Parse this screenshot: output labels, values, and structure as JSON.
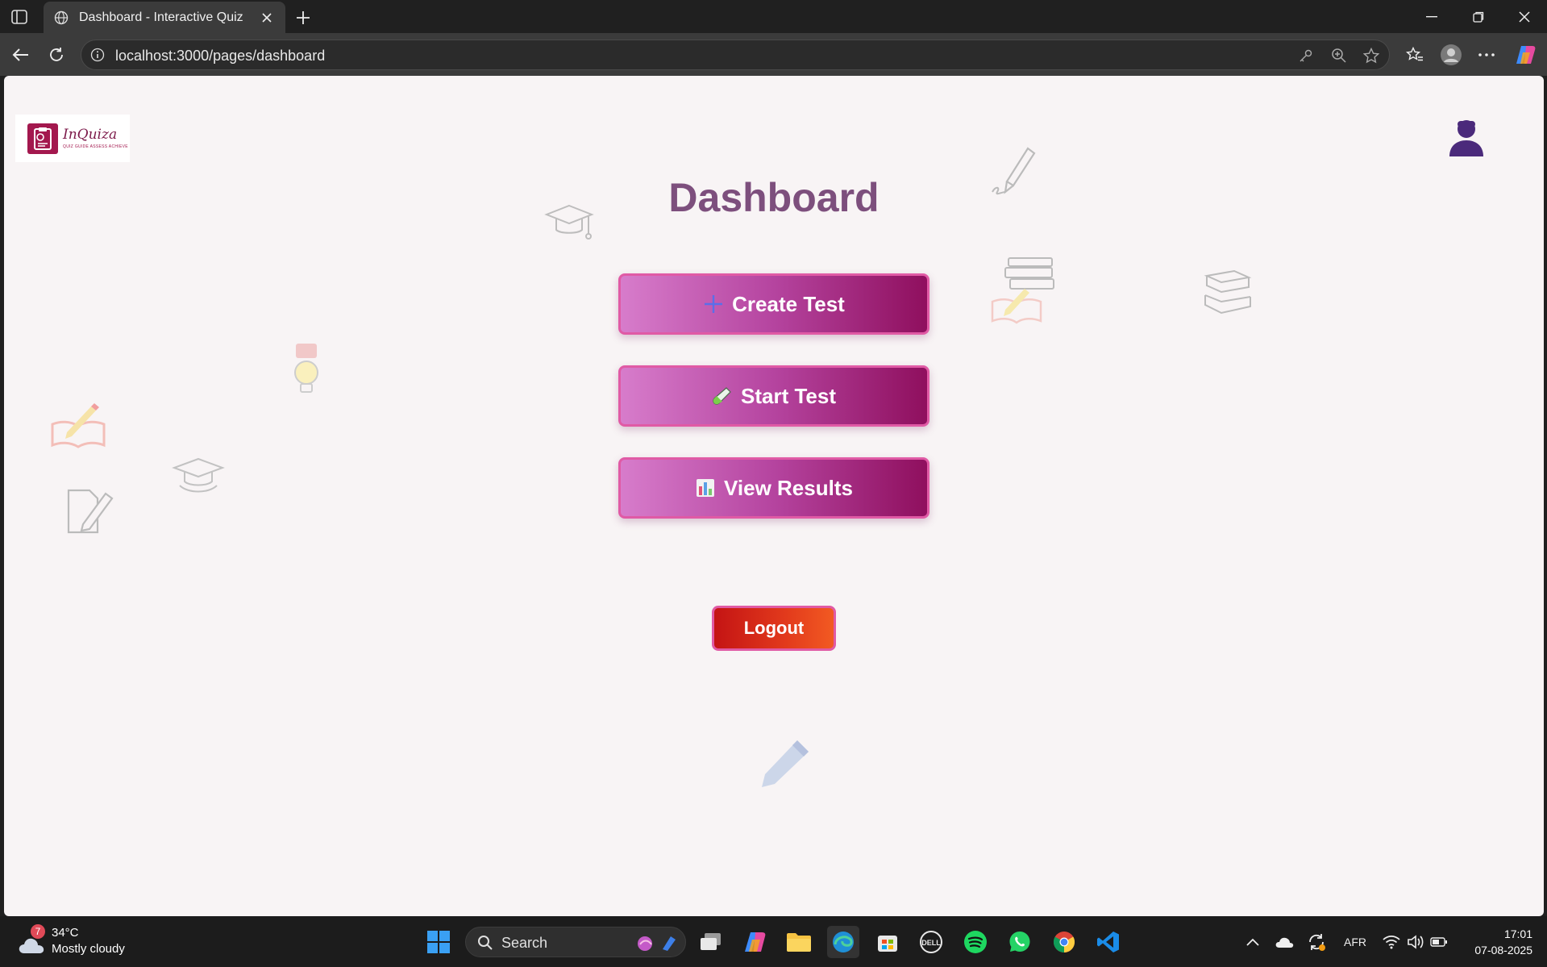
{
  "browser": {
    "tab_title": "Dashboard - Interactive Quiz",
    "url": "localhost:3000/pages/dashboard"
  },
  "page": {
    "logo": {
      "brand": "InQuiza",
      "tagline": "QUIZ GUIDE ASSESS ACHIEVE"
    },
    "title": "Dashboard",
    "buttons": {
      "create_test": "Create Test",
      "start_test": "Start Test",
      "view_results": "View Results",
      "logout": "Logout"
    },
    "colors": {
      "title": "#7d4f7d",
      "button_gradient_start": "#d77ccb",
      "button_gradient_end": "#8f0f5e",
      "logout_gradient_start": "#c41414",
      "logout_gradient_end": "#f25a22",
      "avatar": "#4b2a7b"
    },
    "decorative_icons": [
      "graduation-cap-icon",
      "pen-icon",
      "books-icon",
      "lightbulb-icon",
      "open-book-pencil-icon",
      "document-pencil-icon",
      "pencil-icon"
    ]
  },
  "taskbar": {
    "weather": {
      "badge": "7",
      "temperature": "34°C",
      "condition": "Mostly cloudy"
    },
    "search_label": "Search",
    "language": "AFR",
    "time": "17:01",
    "date": "07-08-2025",
    "pinned_apps": [
      "start-icon",
      "task-view-icon",
      "copilot-icon",
      "file-explorer-icon",
      "edge-icon",
      "store-icon",
      "dell-icon",
      "spotify-icon",
      "whatsapp-icon",
      "chrome-icon",
      "vscode-icon"
    ]
  }
}
